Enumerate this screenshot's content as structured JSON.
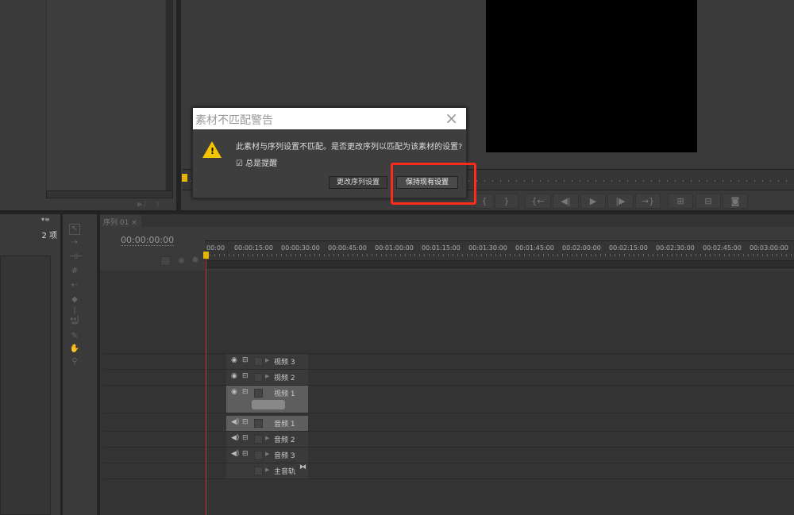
{
  "dialog": {
    "title": "素材不匹配警告",
    "close_icon": "close-icon",
    "message": "此素材与序列设置不匹配。是否更改序列以匹配为该素材的设置?",
    "checkbox_label": "总是提醒",
    "checkbox_checked": true,
    "change_button": "更改序列设置",
    "keep_button": "保持现有设置",
    "highlight_color": "#ff2a1a"
  },
  "project": {
    "item_count": "2 项"
  },
  "timeline": {
    "tab": "序列 01",
    "tab_close": "×",
    "timecode": "00:00:00:00",
    "ruler": [
      "00:00",
      "00:00:15:00",
      "00:00:30:00",
      "00:00:45:00",
      "00:01:00:00",
      "00:01:15:00",
      "00:01:30:00",
      "00:01:45:00",
      "00:02:00:00",
      "00:02:15:00",
      "00:02:30:00",
      "00:02:45:00",
      "00:03:00:00"
    ],
    "tracks": [
      {
        "label": "视频 3",
        "type": "video"
      },
      {
        "label": "视频 2",
        "type": "video"
      },
      {
        "label": "视频 1",
        "type": "video"
      },
      {
        "label": "音频 1",
        "type": "audio"
      },
      {
        "label": "音频 2",
        "type": "audio"
      },
      {
        "label": "音频 3",
        "type": "audio"
      },
      {
        "label": "主音轨",
        "type": "master"
      }
    ],
    "playhead_color": "#c0392b"
  },
  "monitor": {
    "buttons": [
      "{",
      "}",
      "{←",
      "◀|",
      "▶",
      "|▶",
      "→}",
      "lift",
      "extract",
      "camera"
    ]
  }
}
